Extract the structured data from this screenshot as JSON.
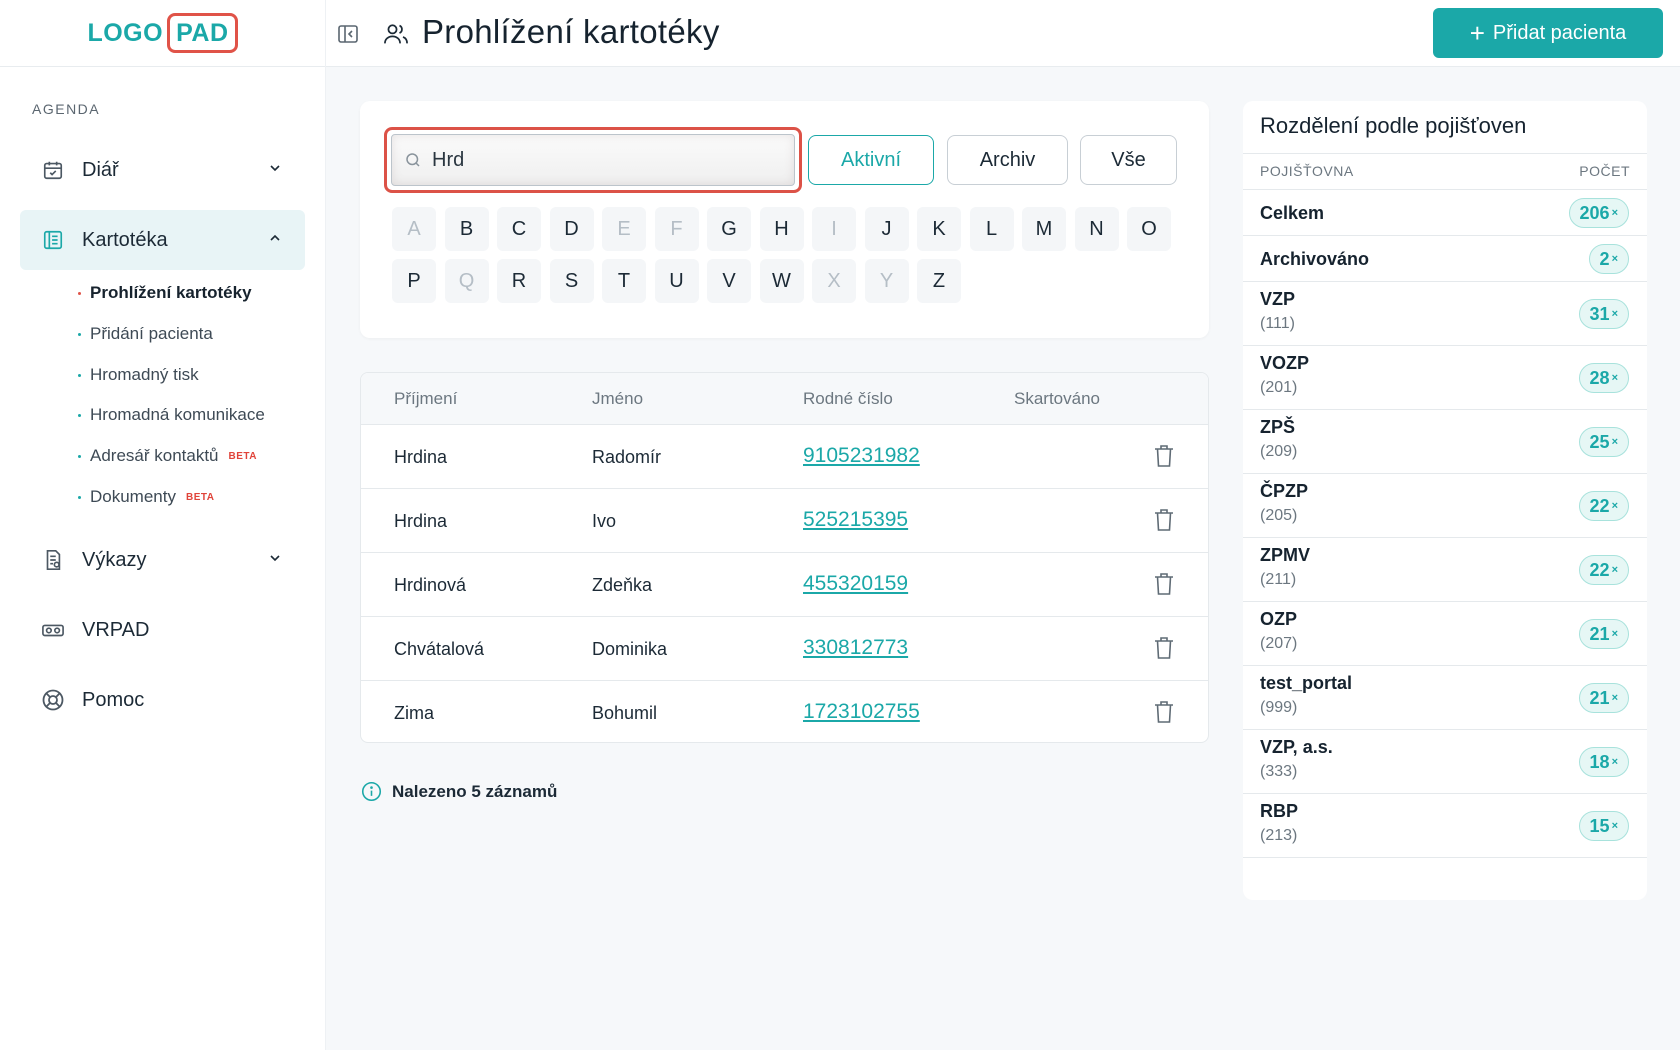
{
  "logo": {
    "part1": "LOGO",
    "part2": "PAD"
  },
  "sidebar": {
    "section_label": "AGENDA",
    "items": [
      {
        "label": "Diář"
      },
      {
        "label": "Kartotéka"
      },
      {
        "label": "Výkazy"
      },
      {
        "label": "VRPAD"
      },
      {
        "label": "Pomoc"
      }
    ],
    "sub_items": [
      {
        "label": "Prohlížení kartotéky",
        "badge": ""
      },
      {
        "label": "Přidání pacienta",
        "badge": ""
      },
      {
        "label": "Hromadný tisk",
        "badge": ""
      },
      {
        "label": "Hromadná komunikace",
        "badge": ""
      },
      {
        "label": "Adresář kontaktů",
        "badge": "BETA"
      },
      {
        "label": "Dokumenty",
        "badge": "BETA"
      }
    ]
  },
  "header": {
    "title": "Prohlížení kartotéky",
    "add_button": "Přidat pacienta"
  },
  "filter": {
    "search_value": "Hrd",
    "buttons": {
      "active": "Aktivní",
      "archive": "Archiv",
      "all": "Vše"
    },
    "letters_row1": [
      "A",
      "B",
      "C",
      "D",
      "E",
      "F",
      "G",
      "H",
      "I",
      "J",
      "K",
      "L",
      "M",
      "N",
      "O"
    ],
    "letters_row2": [
      "P",
      "Q",
      "R",
      "S",
      "T",
      "U",
      "V",
      "W",
      "X",
      "Y",
      "Z"
    ],
    "disabled_letters": [
      "A",
      "E",
      "F",
      "I",
      "Q",
      "X",
      "Y"
    ]
  },
  "table": {
    "headers": {
      "surname": "Příjmení",
      "name": "Jméno",
      "birth_number": "Rodné číslo",
      "shredded": "Skartováno"
    },
    "rows": [
      {
        "surname": "Hrdina",
        "name": "Radomír",
        "birth_number": "9105231982"
      },
      {
        "surname": "Hrdina",
        "name": "Ivo",
        "birth_number": "525215395"
      },
      {
        "surname": "Hrdinová",
        "name": "Zdeňka",
        "birth_number": "455320159"
      },
      {
        "surname": "Chvátalová",
        "name": "Dominika",
        "birth_number": "330812773"
      },
      {
        "surname": "Zima",
        "name": "Bohumil",
        "birth_number": "1723102755"
      }
    ]
  },
  "found_text": "Nalezeno 5 záznamů",
  "insurance": {
    "title": "Rozdělení podle pojišťoven",
    "col_insurer": "POJIŠŤOVNA",
    "col_count": "POČET",
    "rows": [
      {
        "name": "Celkem",
        "code": "",
        "count": "206"
      },
      {
        "name": "Archivováno",
        "code": "",
        "count": "2"
      },
      {
        "name": "VZP",
        "code": "(111)",
        "count": "31"
      },
      {
        "name": "VOZP",
        "code": "(201)",
        "count": "28"
      },
      {
        "name": "ZPŠ",
        "code": "(209)",
        "count": "25"
      },
      {
        "name": "ČPZP",
        "code": "(205)",
        "count": "22"
      },
      {
        "name": "ZPMV",
        "code": "(211)",
        "count": "22"
      },
      {
        "name": "OZP",
        "code": "(207)",
        "count": "21"
      },
      {
        "name": "test_portal",
        "code": "(999)",
        "count": "21"
      },
      {
        "name": "VZP, a.s.",
        "code": "(333)",
        "count": "18"
      },
      {
        "name": "RBP",
        "code": "(213)",
        "count": "15"
      }
    ],
    "count_suffix": "×"
  },
  "colors": {
    "accent": "#1ba8a8",
    "highlight_red": "#dc5247",
    "beta_red": "#e0443a"
  },
  "icons": [
    "calendar-icon",
    "card-file-icon",
    "report-icon",
    "vr-headset-icon",
    "lifebuoy-icon",
    "sidebar-collapse-icon",
    "users-icon",
    "plus-icon",
    "search-icon",
    "trash-icon",
    "info-icon",
    "chevron-down-icon",
    "chevron-up-icon"
  ]
}
